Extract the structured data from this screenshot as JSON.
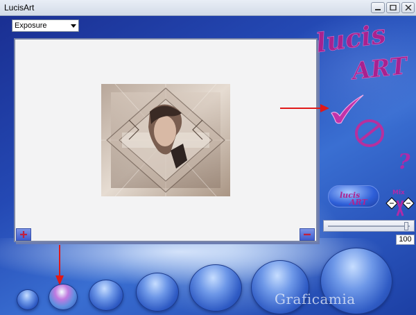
{
  "window": {
    "title": "LucisArt"
  },
  "toolbar": {
    "effect_selected": "Exposure"
  },
  "logo": {
    "text_lucis": "lucis",
    "text_art": "ART"
  },
  "actions": {
    "mix_label": "Mix"
  },
  "slider": {
    "value": "100",
    "level": 100
  },
  "watermark": {
    "text": "Graficamia"
  },
  "colors": {
    "accent_magenta": "#b02aa8",
    "annotation_red": "#e01818",
    "background_blue": "#2449b4"
  }
}
